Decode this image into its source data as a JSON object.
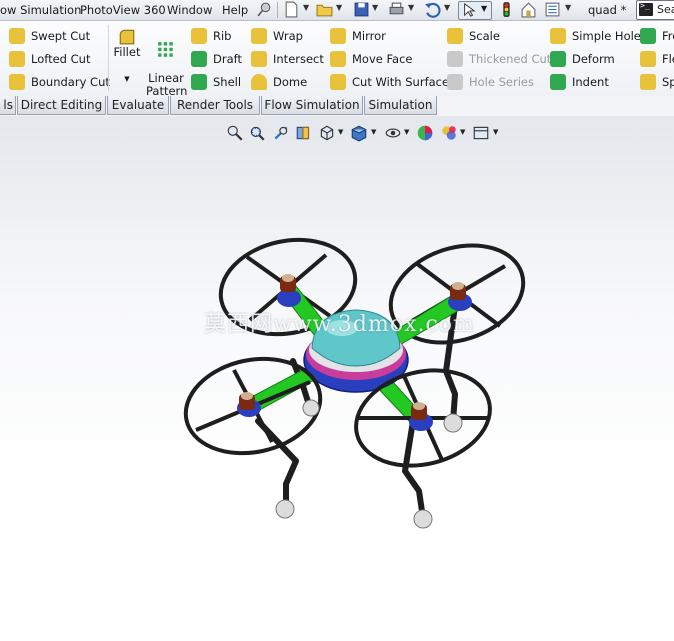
{
  "menubar": {
    "items": [
      "ow Simulation",
      "PhotoView 360",
      "Window",
      "Help"
    ],
    "doc_title": "quad *",
    "search_placeholder": "Sea"
  },
  "ribbon": {
    "col1": [
      "Swept Cut",
      "Lofted Cut",
      "Boundary Cut"
    ],
    "fillet": "Fillet",
    "linear_pattern": "Linear\nPattern",
    "col3": [
      "Rib",
      "Draft",
      "Shell"
    ],
    "col4": [
      "Wrap",
      "Intersect",
      "Dome"
    ],
    "col5": [
      "Mirror",
      "Move Face",
      "Cut With Surface"
    ],
    "col6": [
      "Scale",
      "Thickened Cut",
      "Hole Series"
    ],
    "col7": [
      "Simple Hole",
      "Deform",
      "Indent"
    ],
    "col8": [
      "Fre",
      "Fle",
      "Sp"
    ],
    "colors": {
      "yellow": "#e8c23a",
      "green": "#2fa84f",
      "blue": "#2a6fcf",
      "grey": "#b8b8b8"
    }
  },
  "tabs": [
    "ls",
    "Direct Editing",
    "Evaluate",
    "Render Tools",
    "Flow Simulation",
    "Simulation"
  ],
  "hud_icons": [
    "zoom-to-fit-icon",
    "zoom-to-area-icon",
    "previous-view-icon",
    "section-view-icon",
    "view-orientation-icon",
    "display-style-icon",
    "hide-show-items-icon",
    "edit-appearance-icon",
    "apply-scene-icon",
    "view-settings-icon"
  ],
  "watermark": "莫西网www.3dmox.com",
  "model": {
    "name": "quad",
    "colors": {
      "frame": "#1e1e1e",
      "arm": "#23c823",
      "body": "#5fc7c9",
      "body_ring": "#c83c9c",
      "motor": "#2a3fc0",
      "prop_hub": "#7a2a10",
      "foot": "#dcdcdc"
    }
  }
}
